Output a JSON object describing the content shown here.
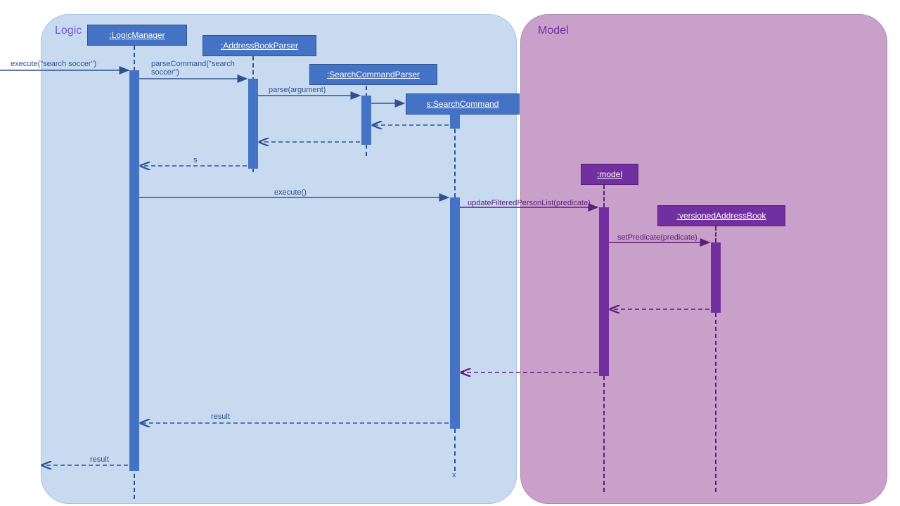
{
  "frames": {
    "logic": "Logic",
    "model": "Model"
  },
  "heads": {
    "logicManager": ":LogicManager",
    "addressBookParser": ":AddressBookParser",
    "searchCommandParser": ":SearchCommandParser",
    "searchCommand": "s:SearchCommand",
    "model": ":model",
    "versionedAddressBook": ":versionedAddressBook"
  },
  "messages": {
    "executeSearch": "execute(\"search soccer\")",
    "parseCommand": "parseCommand(\"search soccer\")",
    "parseArgument": "parse(argument)",
    "sReturn": "s",
    "execute": "execute()",
    "updateFiltered": "updateFilteredPersonList(predicate)",
    "setPredicate": "setPredicate(predicate)",
    "result1": "result",
    "result2": "result",
    "destroy": "x"
  },
  "chart_data": {
    "type": "sequence-diagram",
    "frames": [
      {
        "name": "Logic",
        "lifelines": [
          "LogicManager",
          "AddressBookParser",
          "SearchCommandParser",
          "SearchCommand"
        ]
      },
      {
        "name": "Model",
        "lifelines": [
          "model",
          "versionedAddressBook"
        ]
      }
    ],
    "lifelines": [
      {
        "id": "LogicManager",
        "label": ":LogicManager",
        "frame": "Logic"
      },
      {
        "id": "AddressBookParser",
        "label": ":AddressBookParser",
        "frame": "Logic"
      },
      {
        "id": "SearchCommandParser",
        "label": ":SearchCommandParser",
        "frame": "Logic"
      },
      {
        "id": "SearchCommand",
        "label": "s:SearchCommand",
        "frame": "Logic",
        "created_by": "SearchCommandParser"
      },
      {
        "id": "model",
        "label": ":model",
        "frame": "Model"
      },
      {
        "id": "versionedAddressBook",
        "label": ":versionedAddressBook",
        "frame": "Model"
      }
    ],
    "messages": [
      {
        "from": "external",
        "to": "LogicManager",
        "label": "execute(\"search soccer\")",
        "type": "call"
      },
      {
        "from": "LogicManager",
        "to": "AddressBookParser",
        "label": "parseCommand(\"search soccer\")",
        "type": "call"
      },
      {
        "from": "AddressBookParser",
        "to": "SearchCommandParser",
        "label": "parse(argument)",
        "type": "call"
      },
      {
        "from": "SearchCommandParser",
        "to": "SearchCommand",
        "label": "",
        "type": "create"
      },
      {
        "from": "SearchCommand",
        "to": "SearchCommandParser",
        "label": "",
        "type": "return"
      },
      {
        "from": "SearchCommandParser",
        "to": "AddressBookParser",
        "label": "",
        "type": "return"
      },
      {
        "from": "AddressBookParser",
        "to": "LogicManager",
        "label": "s",
        "type": "return"
      },
      {
        "from": "LogicManager",
        "to": "SearchCommand",
        "label": "execute()",
        "type": "call"
      },
      {
        "from": "SearchCommand",
        "to": "model",
        "label": "updateFilteredPersonList(predicate)",
        "type": "call"
      },
      {
        "from": "model",
        "to": "versionedAddressBook",
        "label": "setPredicate(predicate)",
        "type": "call"
      },
      {
        "from": "versionedAddressBook",
        "to": "model",
        "label": "",
        "type": "return"
      },
      {
        "from": "model",
        "to": "SearchCommand",
        "label": "",
        "type": "return"
      },
      {
        "from": "SearchCommand",
        "to": "LogicManager",
        "label": "result",
        "type": "return"
      },
      {
        "from": "LogicManager",
        "to": "external",
        "label": "result",
        "type": "return"
      },
      {
        "from": "SearchCommand",
        "to": "SearchCommand",
        "label": "x",
        "type": "destroy"
      }
    ]
  }
}
